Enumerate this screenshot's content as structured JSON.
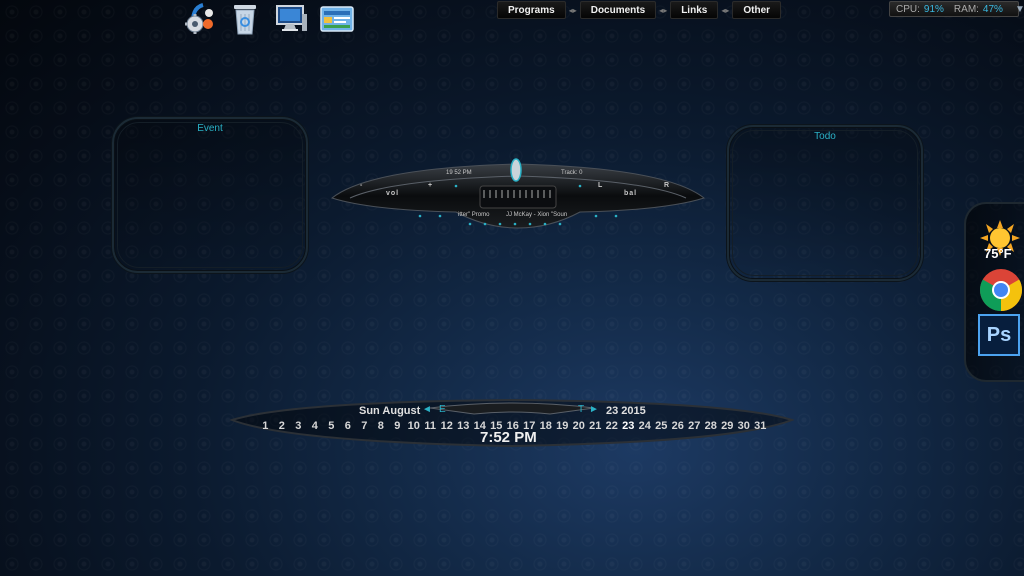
{
  "menu": {
    "items": [
      "Programs",
      "Documents",
      "Links",
      "Other"
    ]
  },
  "sysmon": {
    "cpu_label": "CPU:",
    "cpu_value": "91%",
    "ram_label": "RAM:",
    "ram_value": "47%",
    "dropdown_icon": "triangle-down-icon"
  },
  "dock": {
    "icons": [
      "settings-gear-icon",
      "recycle-bin-icon",
      "computer-icon",
      "control-panel-icon"
    ]
  },
  "event_panel": {
    "title": "Event"
  },
  "todo_panel": {
    "title": "Todo"
  },
  "player": {
    "time": "19 52 PM",
    "track": "Track: 0",
    "vol_minus": "-",
    "vol_label": "vol",
    "vol_plus": "+",
    "bal_left": "L",
    "bal_label": "bal",
    "bal_right": "R",
    "now_playing_1": "itter\" Promo",
    "now_playing_2": "JJ McKay - Xion \"Soun"
  },
  "calendar": {
    "weekday_month": "Sun August",
    "prev_letter": "E",
    "next_letter": "T",
    "date_year": "23 2015",
    "days": [
      "1",
      "2",
      "3",
      "4",
      "5",
      "6",
      "7",
      "8",
      "9",
      "10",
      "11",
      "12",
      "13",
      "14",
      "15",
      "16",
      "17",
      "18",
      "19",
      "20",
      "21",
      "22",
      "23",
      "24",
      "25",
      "26",
      "27",
      "28",
      "29",
      "30",
      "31"
    ],
    "today": "23",
    "time": "7:52 PM"
  },
  "weather": {
    "temp": "75°F",
    "icon": "sunny-icon"
  },
  "right_dock": {
    "icons": [
      "chrome-icon",
      "photoshop-icon"
    ],
    "ps_label": "Ps"
  },
  "colors": {
    "accent": "#2ab1c6",
    "cpu_text": "#3ab8e0"
  }
}
